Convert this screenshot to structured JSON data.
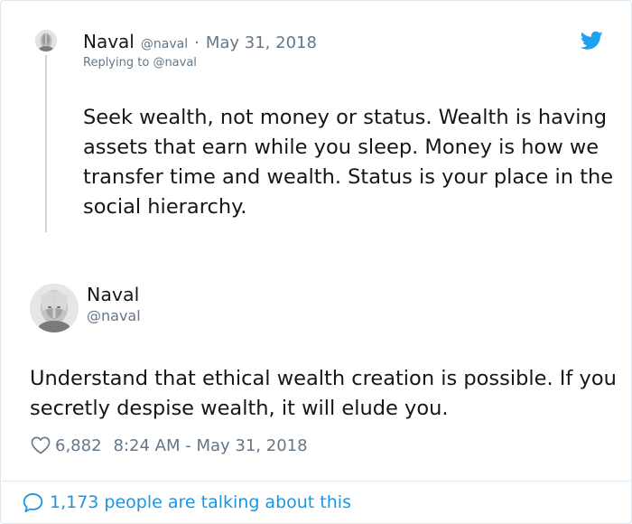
{
  "parent_tweet": {
    "author_name": "Naval",
    "author_handle": "@naval",
    "separator": "·",
    "date": "May 31, 2018",
    "replying_label": "Replying to",
    "replying_handle": "@naval",
    "text": "Seek wealth, not money or status. Wealth is having assets that earn while you sleep. Money is how we transfer time and wealth. Status is your place in the social hierarchy."
  },
  "main_tweet": {
    "author_name": "Naval",
    "author_handle": "@naval",
    "text": "Understand that ethical wealth creation is possible. If you secretly despise wealth, it will elude you.",
    "like_count": "6,882",
    "timestamp": "8:24 AM - May 31, 2018"
  },
  "footer": {
    "talking_text": "1,173 people are talking about this"
  },
  "icons": {
    "brand": "twitter-bird-icon",
    "like": "heart-icon",
    "reply": "speech-bubble-icon"
  },
  "colors": {
    "brand_blue": "#1da1f2",
    "link_blue": "#1b95e0",
    "text_primary": "#14171a",
    "text_secondary": "#657786",
    "border": "#e1e8ed"
  }
}
